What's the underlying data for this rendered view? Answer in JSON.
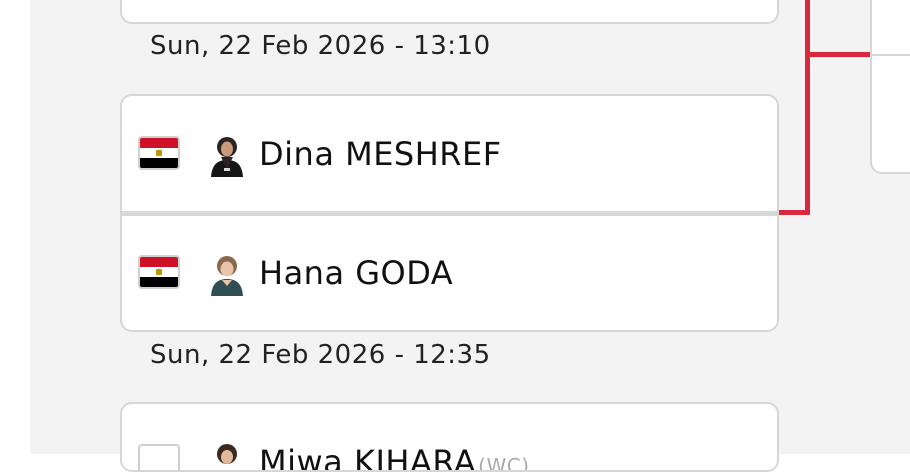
{
  "matches": [
    {
      "time": "Sun, 22 Feb 2026 - 13:10",
      "players": [
        {
          "flag": "egypt-flag-icon",
          "name": "Dina MESHREF",
          "avatar": "player-avatar"
        },
        {
          "flag": "egypt-flag-icon",
          "name": "Hana GODA",
          "avatar": "player-avatar"
        }
      ]
    },
    {
      "time": "Sun, 22 Feb 2026 - 12:35",
      "players": [
        {
          "name": "Miwa KIHARA",
          "seed": "(WC)",
          "avatar": "player-avatar"
        }
      ]
    }
  ],
  "colors": {
    "connector": "#d8283d",
    "background": "#f3f3f3",
    "card_border": "#d6d6d6"
  }
}
